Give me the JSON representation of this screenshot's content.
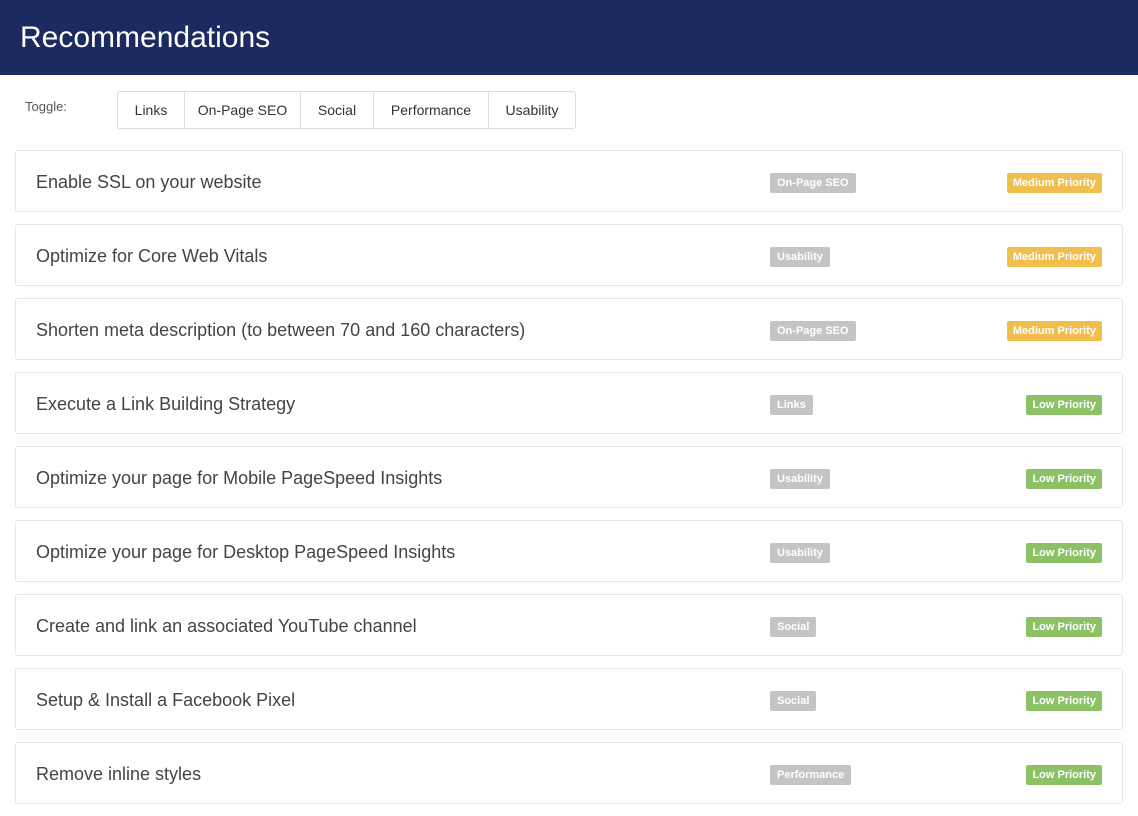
{
  "header": {
    "title": "Recommendations",
    "background_color": "#1b2a61"
  },
  "toggle": {
    "label": "Toggle:",
    "buttons": [
      {
        "label": "Links"
      },
      {
        "label": "On-Page SEO"
      },
      {
        "label": "Social"
      },
      {
        "label": "Performance"
      },
      {
        "label": "Usability"
      }
    ]
  },
  "colors": {
    "category_badge": "#c4c4c4",
    "medium_priority": "#f0be4c",
    "low_priority": "#8cc265"
  },
  "recommendations": [
    {
      "title": "Enable SSL on your website",
      "category": "On-Page SEO",
      "priority": "Medium Priority",
      "level": "medium"
    },
    {
      "title": "Optimize for Core Web Vitals",
      "category": "Usability",
      "priority": "Medium Priority",
      "level": "medium"
    },
    {
      "title": "Shorten meta description (to between 70 and 160 characters)",
      "category": "On-Page SEO",
      "priority": "Medium Priority",
      "level": "medium"
    },
    {
      "title": "Execute a Link Building Strategy",
      "category": "Links",
      "priority": "Low Priority",
      "level": "low"
    },
    {
      "title": "Optimize your page for Mobile PageSpeed Insights",
      "category": "Usability",
      "priority": "Low Priority",
      "level": "low"
    },
    {
      "title": "Optimize your page for Desktop PageSpeed Insights",
      "category": "Usability",
      "priority": "Low Priority",
      "level": "low"
    },
    {
      "title": "Create and link an associated YouTube channel",
      "category": "Social",
      "priority": "Low Priority",
      "level": "low"
    },
    {
      "title": "Setup & Install a Facebook Pixel",
      "category": "Social",
      "priority": "Low Priority",
      "level": "low"
    },
    {
      "title": "Remove inline styles",
      "category": "Performance",
      "priority": "Low Priority",
      "level": "low"
    }
  ]
}
